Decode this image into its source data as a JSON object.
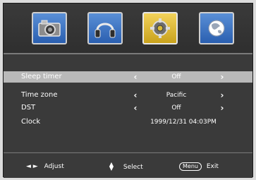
{
  "tabs": [
    {
      "name": "camera-icon",
      "selected": false
    },
    {
      "name": "headphones-icon",
      "selected": false
    },
    {
      "name": "gear-icon",
      "selected": true
    },
    {
      "name": "globe-icon",
      "selected": false
    }
  ],
  "menu": {
    "rows": [
      {
        "label": "Sleep timer",
        "value": "Off",
        "selected": true
      },
      {
        "label": "Time zone",
        "value": "Pacific",
        "selected": false
      },
      {
        "label": "DST",
        "value": "Off",
        "selected": false
      },
      {
        "label": "Clock",
        "value": "1999/12/31 04:03PM",
        "selected": false
      }
    ]
  },
  "footer": {
    "adjust_label": "Adjust",
    "select_label": "Select",
    "menu_key": "Menu",
    "exit_label": "Exit"
  },
  "colors": {
    "panel": "#3c3c3c",
    "selected_row": "#b9b9b9",
    "tab_blue": "#2a5fb0",
    "tab_gold": "#c9a21d"
  }
}
